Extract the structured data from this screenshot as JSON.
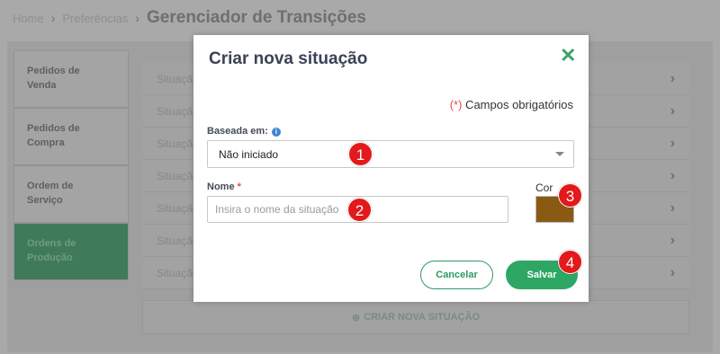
{
  "breadcrumb": {
    "home": "Home",
    "preferences": "Preferências",
    "current": "Gerenciador de Transições"
  },
  "sidebar": {
    "items": [
      {
        "line1": "Pedidos de",
        "line2": "Venda"
      },
      {
        "line1": "Pedidos de",
        "line2": "Compra"
      },
      {
        "line1": "Ordem de",
        "line2": "Serviço"
      },
      {
        "line1": "Ordens de",
        "line2": "Produção"
      }
    ]
  },
  "list": {
    "rows": [
      "Situação",
      "Situação",
      "Situação",
      "Situação",
      "Situação",
      "Situação",
      "Situação"
    ],
    "create_label": "CRIAR NOVA SITUAÇÃO"
  },
  "modal": {
    "title": "Criar nova situação",
    "required_asterisk": "(*)",
    "required_text": " Campos obrigatórios",
    "based_on_label": "Baseada em:",
    "based_on_value": "Não iniciado",
    "name_label": "Nome",
    "name_required": "*",
    "name_placeholder": "Insira o nome da situação",
    "color_label": "Cor",
    "color_value": "#8b5a12",
    "cancel_label": "Cancelar",
    "save_label": "Salvar"
  },
  "markers": [
    "1",
    "2",
    "3",
    "4"
  ],
  "icons": {
    "close": "close-icon",
    "info": "info-icon",
    "chevron": "chevron-right-icon",
    "caret": "caret-down-icon",
    "plus": "plus-circle-icon"
  },
  "colors": {
    "accent": "#2ea764",
    "marker": "#e3191b",
    "title": "#3b4257"
  }
}
